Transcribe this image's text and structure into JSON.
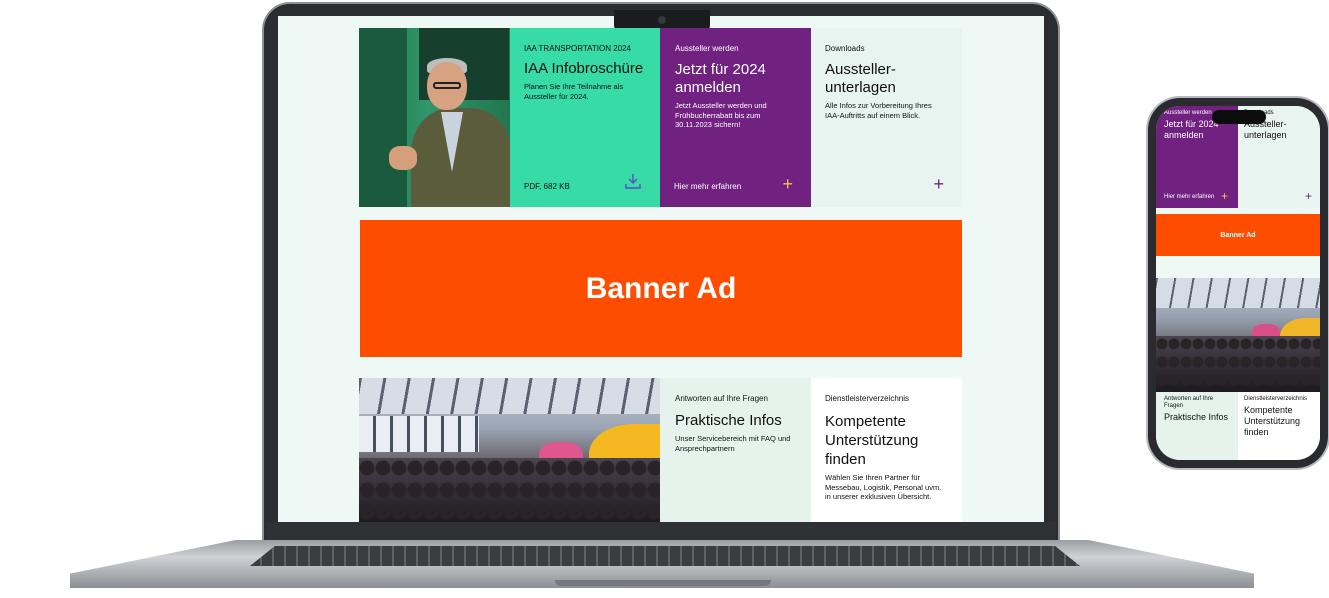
{
  "laptop": {
    "tiles": {
      "infobroschuere": {
        "eyebrow": "IAA TRANSPORTATION 2024",
        "heading": "IAA Infobroschüre",
        "body": "Planen Sie Ihre Teilnahme als Aussteller für 2024.",
        "footer": "PDF, 682 KB",
        "icon": "download-icon"
      },
      "aussteller_werden": {
        "eyebrow": "Aussteller werden",
        "heading": "Jetzt für 2024 anmelden",
        "body": "Jetzt Aussteller werden und Frühbucherrabatt bis zum 30.11.2023 sichern!",
        "footer": "Hier mehr erfahren",
        "icon": "plus-icon"
      },
      "downloads": {
        "eyebrow": "Downloads",
        "heading": "Aussteller-unterlagen",
        "body": "Alle Infos zur Vorbereitung Ihres IAA-Auftritts auf einem Blick.",
        "icon": "plus-icon"
      },
      "praktische_infos": {
        "eyebrow": "Antworten auf Ihre Fragen",
        "heading": "Praktische Infos",
        "body": "Unser Servicebereich mit FAQ und Ansprechpartnern"
      },
      "dienstleister": {
        "eyebrow": "Dienstleisterverzeichnis",
        "heading": "Kompetente Unterstützung finden",
        "body": "Wählen Sie Ihren Partner für Messebau, Logistik, Personal uvm. in unserer exklusiven Übersicht."
      }
    },
    "banner": {
      "label": "Banner Ad"
    }
  },
  "phone": {
    "aussteller": {
      "eyebrow": "Aussteller werden",
      "heading": "Jetzt für 2024 anmelden",
      "footer": "Hier mehr erfahren"
    },
    "downloads": {
      "eyebrow": "Downloads",
      "heading": "Aussteller-unterlagen"
    },
    "banner": {
      "label": "Banner Ad"
    },
    "praktische": {
      "eyebrow": "Antworten auf Ihre Fragen",
      "heading": "Praktische Infos"
    },
    "dienst": {
      "eyebrow": "Dienstleisterverzeichnis",
      "heading": "Kompetente Unterstützung finden"
    }
  },
  "colors": {
    "green_tile": "#36dba6",
    "purple_tile": "#712180",
    "banner_orange": "#ff4d00",
    "light_mint": "#e8f4ef",
    "accent_yellow": "#e8c84a"
  }
}
